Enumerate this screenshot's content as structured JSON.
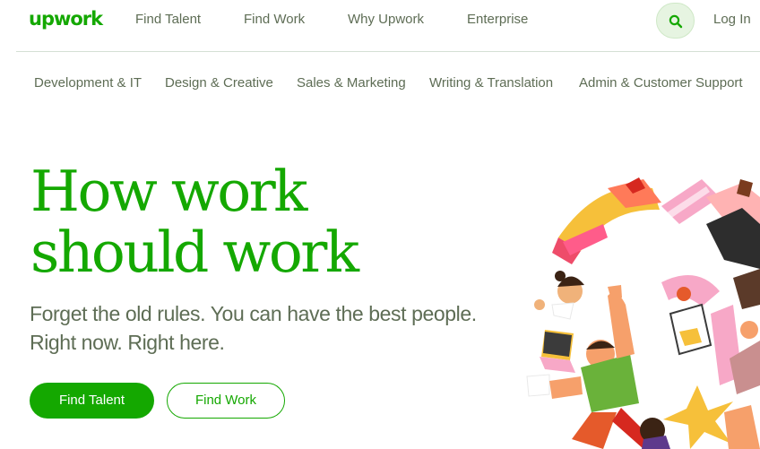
{
  "brand": {
    "logo": "upwork",
    "accent": "#14a800"
  },
  "topnav": {
    "items": [
      "Find Talent",
      "Find Work",
      "Why Upwork",
      "Enterprise"
    ],
    "search_icon": "search-icon",
    "login": "Log In"
  },
  "categories": [
    "Development & IT",
    "Design & Creative",
    "Sales & Marketing",
    "Writing & Translation",
    "Admin & Customer Support"
  ],
  "hero": {
    "title_line1": "How work",
    "title_line2": "should work",
    "subtitle_line1": "Forget the old rules. You can have the best people.",
    "subtitle_line2": "Right now. Right here.",
    "primary_button": "Find Talent",
    "secondary_button": "Find Work"
  }
}
